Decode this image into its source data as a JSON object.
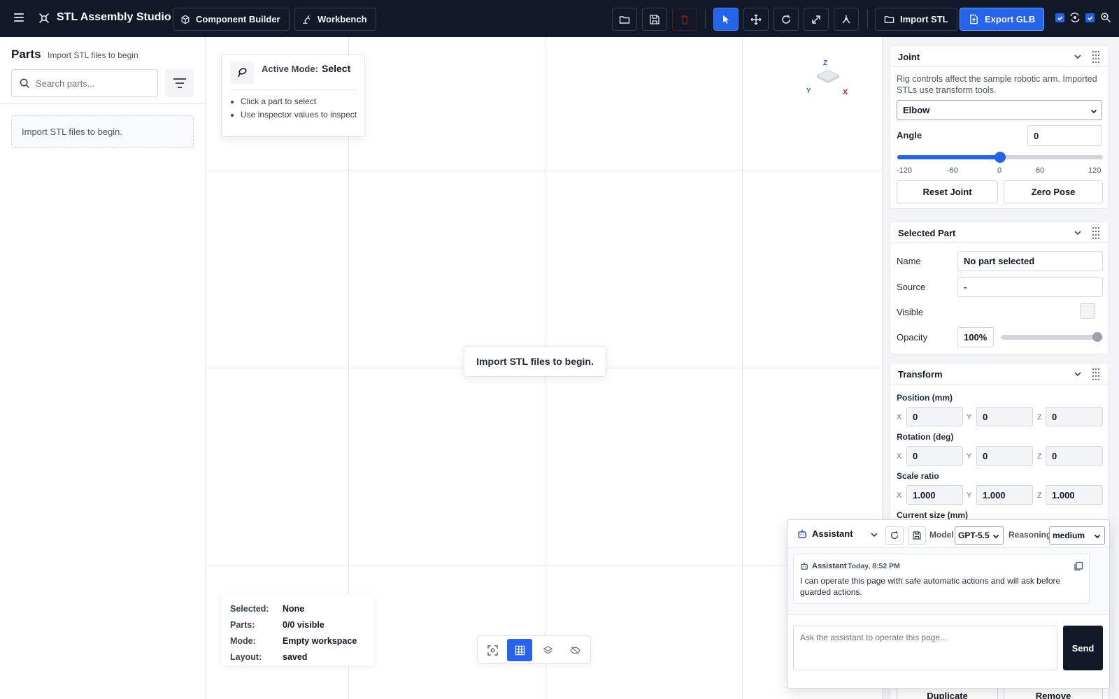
{
  "app": {
    "title": "STL Assembly Studio",
    "nav": [
      "Component Builder",
      "Workbench"
    ],
    "import_label": "Import STL",
    "export_label": "Export GLB",
    "accent": "#2563eb"
  },
  "sidebar": {
    "title": "Parts",
    "subtitle": "Import STL files to begin",
    "search_placeholder": "Search parts...",
    "empty": "Import STL files to begin."
  },
  "viewport": {
    "mode_label": "Active Mode:",
    "mode_value": "Select",
    "hints": [
      "Click a part to select",
      "Use inspector values to inspect"
    ],
    "center_message": "Import STL files to begin.",
    "axes": {
      "x": "X",
      "y": "Y",
      "z": "Z"
    },
    "status": [
      {
        "key": "Selected:",
        "value": "None"
      },
      {
        "key": "Parts:",
        "value": "0/0 visible"
      },
      {
        "key": "Mode:",
        "value": "Empty workspace"
      },
      {
        "key": "Layout:",
        "value": "saved"
      }
    ]
  },
  "joint": {
    "title": "Joint",
    "description": "Rig controls affect the sample robotic arm. Imported STLs use transform tools.",
    "selected_joint": "Elbow",
    "angle_label": "Angle",
    "angle_value": "0",
    "slider_fraction": 0.5,
    "ticks": [
      "-120",
      "-60",
      "0",
      "60",
      "120"
    ],
    "reset_label": "Reset Joint",
    "zero_label": "Zero Pose"
  },
  "selected_part": {
    "title": "Selected Part",
    "name_label": "Name",
    "name_value": "No part selected",
    "source_label": "Source",
    "source_value": "-",
    "visible_label": "Visible",
    "opacity_label": "Opacity",
    "opacity_value": "100%",
    "opacity_fraction": 1.0
  },
  "transform": {
    "title": "Transform",
    "position_label": "Position (mm)",
    "position": [
      "0",
      "0",
      "0"
    ],
    "rotation_label": "Rotation (deg)",
    "rotation": [
      "0",
      "0",
      "0"
    ],
    "scale_label": "Scale ratio",
    "scale": [
      "1.000",
      "1.000",
      "1.000"
    ],
    "size_label": "Current size (mm)",
    "axis_letters": [
      "X",
      "Y",
      "Z"
    ],
    "duplicate_label": "Duplicate",
    "remove_label": "Remove"
  },
  "assistant": {
    "title": "Assistant",
    "model_label": "Model",
    "model_value": "GPT-5.5",
    "reasoning_label": "Reasoning",
    "reasoning_value": "medium",
    "message_author": "Assistant",
    "message_time": "Today, 8:52 PM",
    "message_text": "I can operate this page with safe automatic actions and will ask before guarded actions.",
    "input_placeholder": "Ask the assistant to operate this page...",
    "send_label": "Send"
  }
}
